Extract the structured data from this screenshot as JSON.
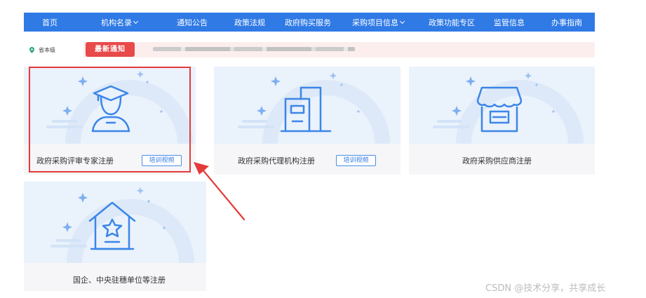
{
  "nav": {
    "items": [
      {
        "label": "首页"
      },
      {
        "label": "机构名录"
      },
      {
        "label": "通知公告"
      },
      {
        "label": "政策法规"
      },
      {
        "label": "政府购买服务"
      },
      {
        "label": "采购项目信息"
      },
      {
        "label": "政策功能专区"
      },
      {
        "label": "监管信息"
      },
      {
        "label": "办事指南"
      }
    ]
  },
  "location": {
    "label": "省本级"
  },
  "notice": {
    "badge": "最新通知"
  },
  "cards": [
    {
      "label": "政府采购评审专家注册",
      "button": "培训视频",
      "icon": "graduate-icon"
    },
    {
      "label": "政府采购代理机构注册",
      "button": "培训视频",
      "icon": "building-icon"
    },
    {
      "label": "政府采购供应商注册",
      "icon": "store-icon"
    },
    {
      "label": "国企、中央驻穗单位等注册",
      "icon": "house-star-icon"
    }
  ],
  "colors": {
    "nav": "#2f7ae5",
    "accent": "#e53a3a",
    "card_bg": "#eaf2fc",
    "icon": "#3b86e8"
  },
  "watermark": "CSDN @技术分享，共享成长"
}
